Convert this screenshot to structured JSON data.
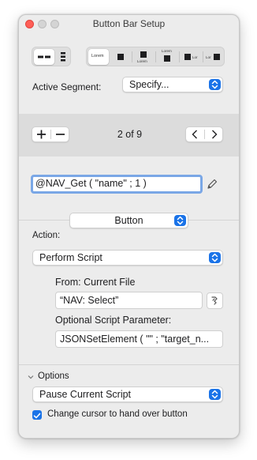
{
  "window": {
    "title": "Button Bar Setup"
  },
  "segment_type_options": [
    "Lorem",
    "Lorem",
    "Lorem",
    "Lor",
    "Lor"
  ],
  "active_segment": {
    "label": "Active Segment:",
    "value": "Specify..."
  },
  "segment_nav": {
    "counter": "2 of 9"
  },
  "calculation": {
    "value": "@NAV_Get ( \"name\" ; 1 )"
  },
  "type_popup": {
    "value": "Button"
  },
  "action": {
    "label": "Action:",
    "value": "Perform Script",
    "from_label": "From: Current File",
    "script_value": "“NAV: Select”",
    "param_label": "Optional Script Parameter:",
    "param_value": "JSONSetElement ( \"\" ; \"target_n..."
  },
  "options": {
    "label": "Options",
    "popup_value": "Pause Current Script",
    "cursor_label": "Change cursor to hand over button",
    "cursor_checked": true
  },
  "colors": {
    "accent": "#1a73e8",
    "close": "#ff5f57"
  }
}
